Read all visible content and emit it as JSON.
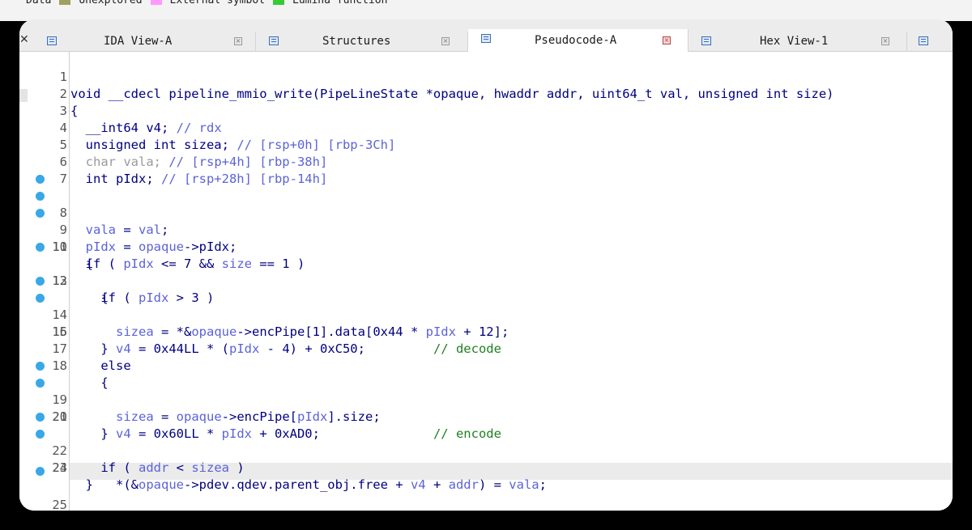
{
  "legend": {
    "items": [
      {
        "label": "Data",
        "color": ""
      },
      {
        "label": "Unexplored",
        "color": "#a0a060"
      },
      {
        "label": "External symbol",
        "color": "#ff99ff"
      },
      {
        "label": "Lumina function",
        "color": "#33cc33"
      }
    ]
  },
  "tabs": [
    {
      "label": "IDA View-A",
      "active": false
    },
    {
      "label": "Structures",
      "active": false
    },
    {
      "label": "Pseudocode-A",
      "active": true
    },
    {
      "label": "Hex View-1",
      "active": false
    }
  ],
  "code": {
    "lines": [
      {
        "num": "1",
        "bp": false
      },
      {
        "num": "2",
        "bp": false
      },
      {
        "num": "3",
        "bp": false
      },
      {
        "num": "4",
        "bp": false
      },
      {
        "num": "5",
        "bp": false
      },
      {
        "num": "6",
        "bp": false
      },
      {
        "num": "7",
        "bp": false
      },
      {
        "num": "8",
        "bp": true
      },
      {
        "num": "9",
        "bp": true
      },
      {
        "num": "10",
        "bp": true
      },
      {
        "num": "11",
        "bp": false
      },
      {
        "num": "12",
        "bp": true
      },
      {
        "num": "13",
        "bp": false
      },
      {
        "num": "14",
        "bp": true
      },
      {
        "num": "15",
        "bp": true
      },
      {
        "num": "16",
        "bp": false
      },
      {
        "num": "17",
        "bp": false
      },
      {
        "num": "18",
        "bp": false
      },
      {
        "num": "19",
        "bp": true
      },
      {
        "num": "20",
        "bp": true
      },
      {
        "num": "21",
        "bp": false
      },
      {
        "num": "22",
        "bp": true
      },
      {
        "num": "23",
        "bp": true
      },
      {
        "num": "24",
        "bp": false
      },
      {
        "num": "25",
        "bp": true
      }
    ],
    "text": {
      "l1": "void __cdecl pipeline_mmio_write(PipeLineState *opaque, hwaddr addr, uint64_t val, unsigned int size)",
      "l2": "{",
      "l3a": "  __int64 v4; ",
      "l3b": "// rdx",
      "l4a": "  unsigned int sizea; ",
      "l4b": "// [rsp+0h] [rbp-3Ch]",
      "l5a": "  char vala; ",
      "l5b": "// [rsp+4h] [rbp-38h]",
      "l6a": "  int pIdx; ",
      "l6b": "// [rsp+28h] [rbp-14h]",
      "l8a": "vala",
      "l8b": " = ",
      "l8c": "val",
      "l8d": ";",
      "l9a": "pIdx",
      "l9b": " = ",
      "l9c": "opaque",
      "l9d": "->pIdx;",
      "l10a": "  if ( ",
      "l10b": "pIdx",
      "l10c": " <= 7 && ",
      "l10d": "size",
      "l10e": " == 1 )",
      "l11": "  {",
      "l12a": "    if ( ",
      "l12b": "pIdx",
      "l12c": " > 3 )",
      "l13": "    {",
      "l14a": "sizea",
      "l14b": " = *&",
      "l14c": "opaque",
      "l14d": "->encPipe[1].data[0x44 * ",
      "l14e": "pIdx",
      "l14f": " + 12];",
      "l15a": "v4",
      "l15b": " = 0x44LL * (",
      "l15c": "pIdx",
      "l15d": " - 4) + 0xC50;         ",
      "l15e": "// decode",
      "l16": "    }",
      "l17": "    else",
      "l18": "    {",
      "l19a": "sizea",
      "l19b": " = ",
      "l19c": "opaque",
      "l19d": "->encPipe[",
      "l19e": "pIdx",
      "l19f": "].size;",
      "l20a": "v4",
      "l20b": " = 0x60LL * ",
      "l20c": "pIdx",
      "l20d": " + 0xAD0;               ",
      "l20e": "// encode",
      "l21": "    }",
      "l22a": "    if ( ",
      "l22b": "addr",
      "l22c": " < ",
      "l22d": "sizea",
      "l22e": " )",
      "l23a": "      *(&",
      "l23b": "opaque",
      "l23c": "->pdev.qdev.parent_obj.free + ",
      "l23d": "v4",
      "l23e": " + ",
      "l23f": "addr",
      "l23g": ") = ",
      "l23h": "vala",
      "l23i": ";",
      "l24": "  }",
      "l25": "}"
    }
  }
}
